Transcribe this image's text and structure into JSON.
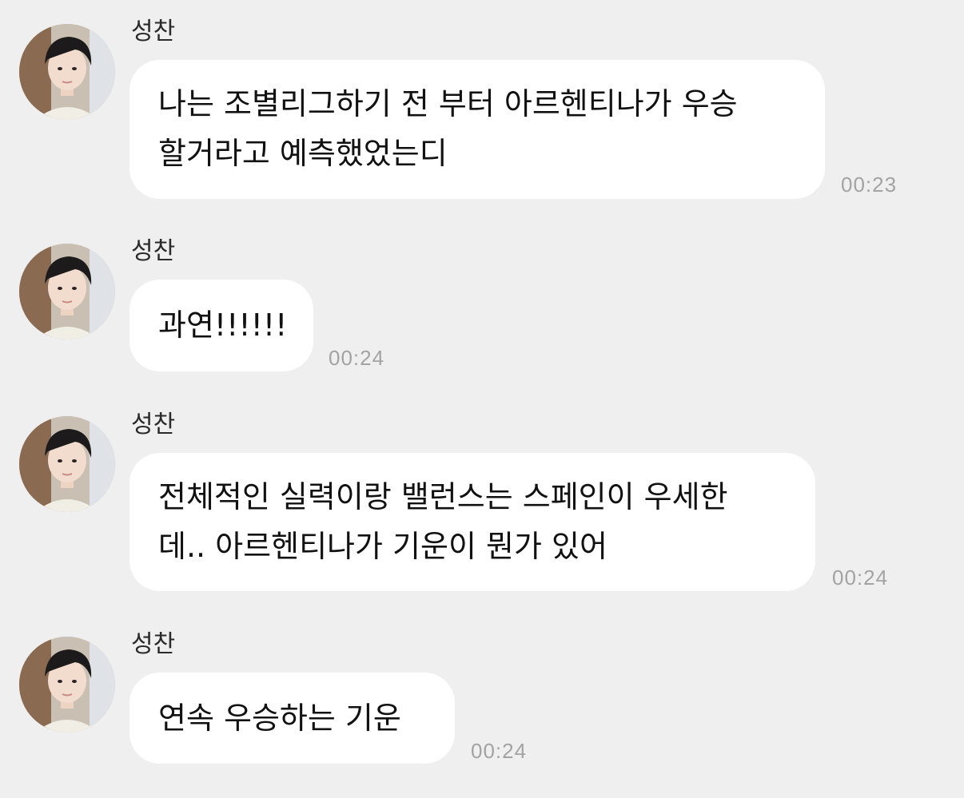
{
  "messages": [
    {
      "sender": "성찬",
      "lines": [
        "나는 조별리그하기 전 부터 아르헨티나가 우승",
        "할거라고 예측했었는디"
      ],
      "time": "00:23"
    },
    {
      "sender": "성찬",
      "lines": [
        "과연!!!!!!"
      ],
      "time": "00:24"
    },
    {
      "sender": "성찬",
      "lines": [
        "전체적인 실력이랑 밸런스는 스페인이 우세한",
        "데.. 아르헨티나가 기운이 뭔가 있어"
      ],
      "time": "00:24"
    },
    {
      "sender": "성찬",
      "lines": [
        "연속 우승하는 기운"
      ],
      "time": "00:24"
    }
  ],
  "colors": {
    "background": "#efefef",
    "bubble": "#ffffff",
    "time": "#a3a3a3"
  }
}
